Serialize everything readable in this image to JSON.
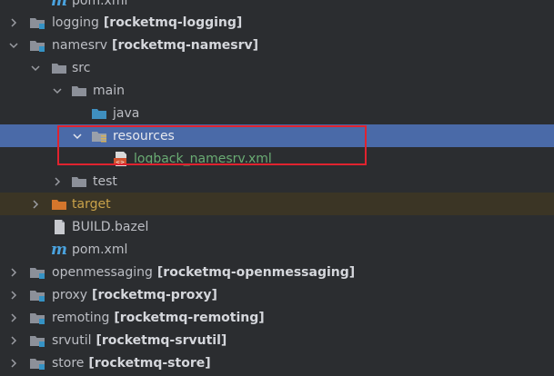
{
  "tree": {
    "top_partial": {
      "label": "pom.xml"
    },
    "rows": [
      {
        "name": "logging",
        "module": "[rocketmq-logging]"
      },
      {
        "name": "namesrv",
        "module": "[rocketmq-namesrv]"
      },
      {
        "name": "src"
      },
      {
        "name": "main"
      },
      {
        "name": "java"
      },
      {
        "name": "resources"
      },
      {
        "name": "logback_namesrv.xml"
      },
      {
        "name": "test"
      },
      {
        "name": "target"
      },
      {
        "name": "BUILD.bazel"
      },
      {
        "name": "pom.xml"
      },
      {
        "name": "openmessaging",
        "module": "[rocketmq-openmessaging]"
      },
      {
        "name": "proxy",
        "module": "[rocketmq-proxy]"
      },
      {
        "name": "remoting",
        "module": "[rocketmq-remoting]"
      },
      {
        "name": "srvutil",
        "module": "[rocketmq-srvutil]"
      },
      {
        "name": "store",
        "module": "[rocketmq-store]"
      }
    ]
  },
  "colors": {
    "background": "#2b2d30",
    "selection": "#4a6aa8",
    "excluded_folder": "#c9a24a",
    "resource_file": "#6aab73",
    "annotation_box": "#e0232f"
  },
  "icons": {
    "expanded": "chevron-down-icon",
    "collapsed": "chevron-right-icon",
    "module": "module-folder-icon",
    "folder": "folder-icon",
    "source_root": "source-root-folder-icon",
    "resources_root": "resources-root-folder-icon",
    "xml": "xml-file-icon",
    "excluded": "excluded-folder-icon",
    "bazel": "file-icon",
    "maven": "maven-icon"
  }
}
